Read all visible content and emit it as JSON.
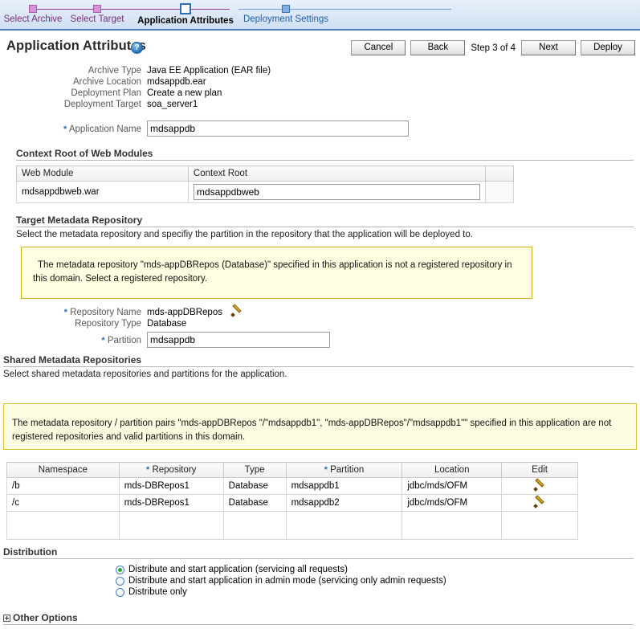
{
  "train": {
    "steps": [
      {
        "label": "Select Archive",
        "state": "visited"
      },
      {
        "label": "Select Target",
        "state": "visited"
      },
      {
        "label": "Application Attributes",
        "state": "current"
      },
      {
        "label": "Deployment Settings",
        "state": "future"
      }
    ]
  },
  "header": {
    "title": "Application Attributes",
    "help_icon": "help-icon",
    "help_glyph": "?",
    "buttons": {
      "cancel": "Cancel",
      "back": "Back",
      "next": "Next",
      "deploy": "Deploy"
    },
    "step_indicator": "Step 3 of 4"
  },
  "summary": {
    "archive_type_label": "Archive Type",
    "archive_type_value": "Java EE Application (EAR file)",
    "archive_location_label": "Archive Location",
    "archive_location_value": "mdsappdb.ear",
    "deployment_plan_label": "Deployment Plan",
    "deployment_plan_value": "Create a new plan",
    "deployment_target_label": "Deployment Target",
    "deployment_target_value": "soa_server1"
  },
  "application_name": {
    "label": "Application Name",
    "required_marker": "*",
    "value": "mdsappdb"
  },
  "context_root_section": {
    "heading": "Context Root of Web Modules",
    "columns": [
      "Web Module",
      "Context Root"
    ],
    "rows": [
      {
        "web_module": "mdsappdbweb.war",
        "context_root": "mdsappdbweb"
      }
    ]
  },
  "target_repository_section": {
    "heading": "Target Metadata Repository",
    "description": "Select the metadata repository and specifiy the partition in the repository that the application will be deployed to.",
    "warning": "The metadata repository \"mds-appDBRepos (Database)\" specified in this application is not a registered repository in this domain. Select a registered repository.",
    "repository_name_label": "Repository Name",
    "repository_name_value": "mds-appDBRepos",
    "repository_name_required": "*",
    "edit_icon": "pencil-icon",
    "repository_type_label": "Repository Type",
    "repository_type_value": "Database",
    "partition_label": "Partition",
    "partition_required": "*",
    "partition_value": "mdsappdb"
  },
  "shared_repository_section": {
    "heading": "Shared Metadata Repositories",
    "description": "Select shared metadata repositories and partitions for the application.",
    "warning": "The metadata repository / partition pairs \"mds-appDBRepos \"/\"mdsappdb1\", \"mds-appDBRepos\"/\"mdsappdb1\"\" specified in this application are not registered repositories and valid partitions in this domain.",
    "columns": [
      "Namespace",
      "Repository",
      "Type",
      "Partition",
      "Location",
      "Edit"
    ],
    "required_columns": [
      "Repository",
      "Partition"
    ],
    "rows": [
      {
        "namespace": "/b",
        "repository": "mds-DBRepos1",
        "type": "Database",
        "partition": "mdsappdb1",
        "location": "jdbc/mds/OFM",
        "edit_icon": "pencil-icon"
      },
      {
        "namespace": "/c",
        "repository": "mds-DBRepos1",
        "type": "Database",
        "partition": "mdsappdb2",
        "location": "jdbc/mds/OFM",
        "edit_icon": "pencil-icon"
      }
    ]
  },
  "distribution_section": {
    "heading": "Distribution",
    "options": [
      {
        "label": "Distribute and start application (servicing all requests)",
        "selected": true
      },
      {
        "label": "Distribute and start application in admin mode (servicing only admin requests)",
        "selected": false
      },
      {
        "label": "Distribute only",
        "selected": false
      }
    ]
  },
  "other_options_section": {
    "heading": "Other Options",
    "expander_icon": "plus-box-icon",
    "expanded": false
  },
  "colors": {
    "train_band": "#dbe7f6",
    "train_border": "#4a7ebb",
    "visited_step": "#7b2d7b",
    "future_step": "#1f5fa9",
    "warning_bg": "#feffe0",
    "warning_border": "#cfae1b",
    "required_star": "#2e6db4",
    "radio_selected": "#2fa82f",
    "pencil": "#e0a800"
  }
}
